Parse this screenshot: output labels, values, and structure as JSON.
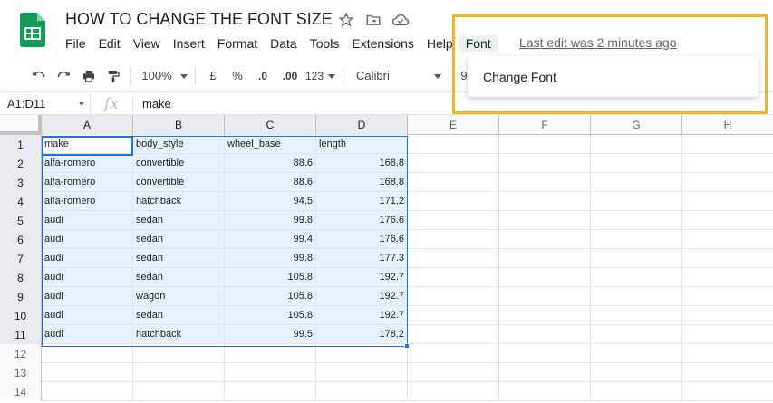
{
  "doc_title": "HOW TO CHANGE THE FONT SIZE",
  "menu": [
    "File",
    "Edit",
    "View",
    "Insert",
    "Format",
    "Data",
    "Tools",
    "Extensions",
    "Help",
    "Font"
  ],
  "active_menu": "Font",
  "last_edit": "Last edit was 2 minutes ago",
  "toolbar": {
    "zoom": "100%",
    "currency": "£",
    "percent": "%",
    "dec_decrease": ".0",
    "dec_increase": ".00",
    "format_more": "123",
    "font": "Calibri",
    "font_size_partial": "9"
  },
  "name_box": "A1:D11",
  "formula": "make",
  "columns": [
    "A",
    "B",
    "C",
    "D",
    "E",
    "F",
    "G",
    "H"
  ],
  "rows": [
    [
      "make",
      "body_style",
      "wheel_base",
      "length"
    ],
    [
      "alfa-romero",
      "convertible",
      "88.6",
      "168.8"
    ],
    [
      "alfa-romero",
      "convertible",
      "88.6",
      "168.8"
    ],
    [
      "alfa-romero",
      "hatchback",
      "94.5",
      "171.2"
    ],
    [
      "audi",
      "sedan",
      "99.8",
      "176.6"
    ],
    [
      "audi",
      "sedan",
      "99.4",
      "176.6"
    ],
    [
      "audi",
      "sedan",
      "99.8",
      "177.3"
    ],
    [
      "audi",
      "sedan",
      "105.8",
      "192.7"
    ],
    [
      "audi",
      "wagon",
      "105.8",
      "192.7"
    ],
    [
      "audi",
      "sedan",
      "105.8",
      "192.7"
    ],
    [
      "audi",
      "hatchback",
      "99.5",
      "178.2"
    ],
    [
      "",
      "",
      "",
      ""
    ],
    [
      "",
      "",
      "",
      ""
    ],
    [
      "",
      "",
      "",
      ""
    ]
  ],
  "dropdown": {
    "item": "Change Font"
  },
  "colors": {
    "accent": "#1a73e8",
    "highlight": "#f0b429",
    "selection": "#e7f0fd",
    "logo": "#0f9d58"
  }
}
